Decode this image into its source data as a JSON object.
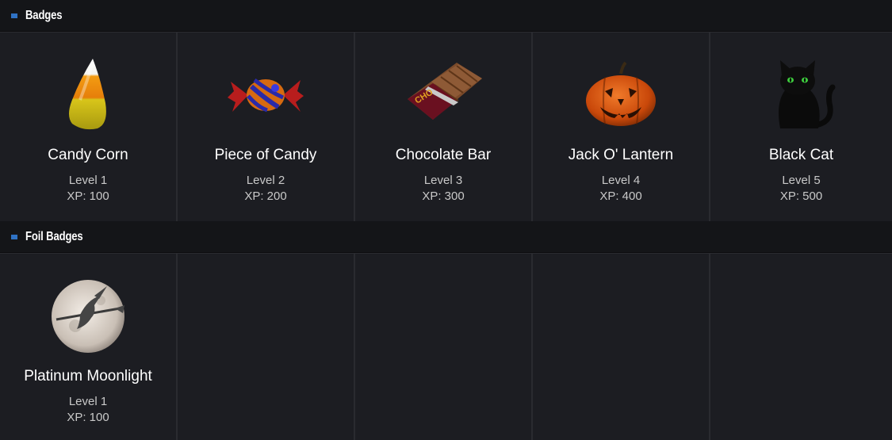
{
  "sections": [
    {
      "title": "Badges",
      "badges": [
        {
          "name": "Candy Corn",
          "level": "Level 1",
          "xp": "XP: 100",
          "icon": "candy-corn-icon"
        },
        {
          "name": "Piece of Candy",
          "level": "Level 2",
          "xp": "XP: 200",
          "icon": "wrapped-candy-icon"
        },
        {
          "name": "Chocolate Bar",
          "level": "Level 3",
          "xp": "XP: 300",
          "icon": "chocolate-bar-icon"
        },
        {
          "name": "Jack O' Lantern",
          "level": "Level 4",
          "xp": "XP: 400",
          "icon": "jack-o-lantern-icon"
        },
        {
          "name": "Black Cat",
          "level": "Level 5",
          "xp": "XP: 500",
          "icon": "black-cat-icon"
        }
      ]
    },
    {
      "title": "Foil Badges",
      "badges": [
        {
          "name": "Platinum Moonlight",
          "level": "Level 1",
          "xp": "XP: 100",
          "icon": "moon-witch-icon"
        }
      ]
    }
  ],
  "colors": {
    "accent": "#2f72c4",
    "background": "#1b1c20",
    "header": "#141518"
  }
}
